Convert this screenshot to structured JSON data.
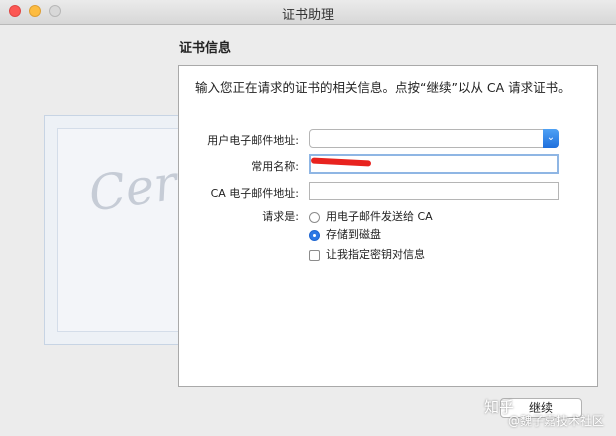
{
  "window": {
    "title": "证书助理"
  },
  "section_title": "证书信息",
  "intro": "输入您正在请求的证书的相关信息。点按“继续”以从 CA 请求证书。",
  "form": {
    "email_label": "用户电子邮件地址:",
    "email_value": "",
    "common_name_label": "常用名称:",
    "common_name_value": "",
    "ca_email_label": "CA 电子邮件地址:",
    "ca_email_value": "",
    "request_label": "请求是:",
    "options": [
      {
        "label": "用电子邮件发送给 CA",
        "selected": false
      },
      {
        "label": "存储到磁盘",
        "selected": true
      }
    ],
    "checkbox_label": "让我指定密钥对信息"
  },
  "buttons": {
    "continue": "继续"
  },
  "watermark": {
    "site": "知乎",
    "text": "@魏子嘉技术社区"
  },
  "colors": {
    "accent": "#2d78e5",
    "redaction": "#e8231f"
  },
  "certificate_art": {
    "script_text": "Certificate"
  }
}
